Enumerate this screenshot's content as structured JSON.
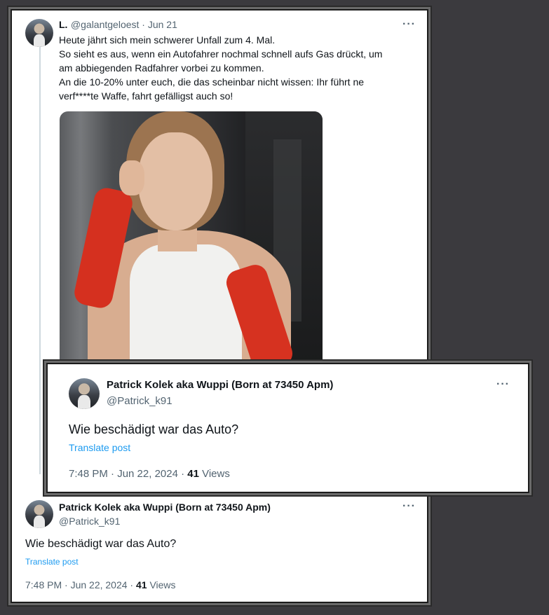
{
  "parent_tweet": {
    "display_name": "L.",
    "handle_date": "@galantgeloest · Jun 21",
    "more": "···",
    "text_lines": [
      "Heute jährt sich mein schwerer Unfall zum 4. Mal.",
      "So sieht es aus, wenn ein Autofahrer nochmal schnell aufs Gas drückt, um",
      "am abbiegenden Radfahrer vorbei zu kommen.",
      "An die 10-20% unter euch, die das scheinbar nicht wissen: Ihr führt ne",
      "verf****te Waffe, fahrt gefälligst auch so!"
    ]
  },
  "reply_front": {
    "display_name": "Patrick Kolek aka Wuppi (Born at 73450 Apm)",
    "handle": "@Patrick_k91",
    "more": "···",
    "text": "Wie beschädigt war das Auto?",
    "translate": "Translate post",
    "time": "7:48 PM · Jun 22, 2024 · ",
    "views_count": "41",
    "views_label": " Views"
  },
  "reply_back": {
    "display_name": "Patrick Kolek aka Wuppi (Born at 73450 Apm)",
    "handle": "@Patrick_k91",
    "more": "···",
    "text": "Wie beschädigt war das Auto?",
    "translate": "Translate post",
    "time": "7:48 PM · Jun 22, 2024 · ",
    "views_count": "41",
    "views_label": " Views"
  },
  "colors": {
    "background": "#3b3a3e",
    "link": "#1d9bf0",
    "secondary_text": "#536471",
    "cast_red": "#d5301f"
  }
}
